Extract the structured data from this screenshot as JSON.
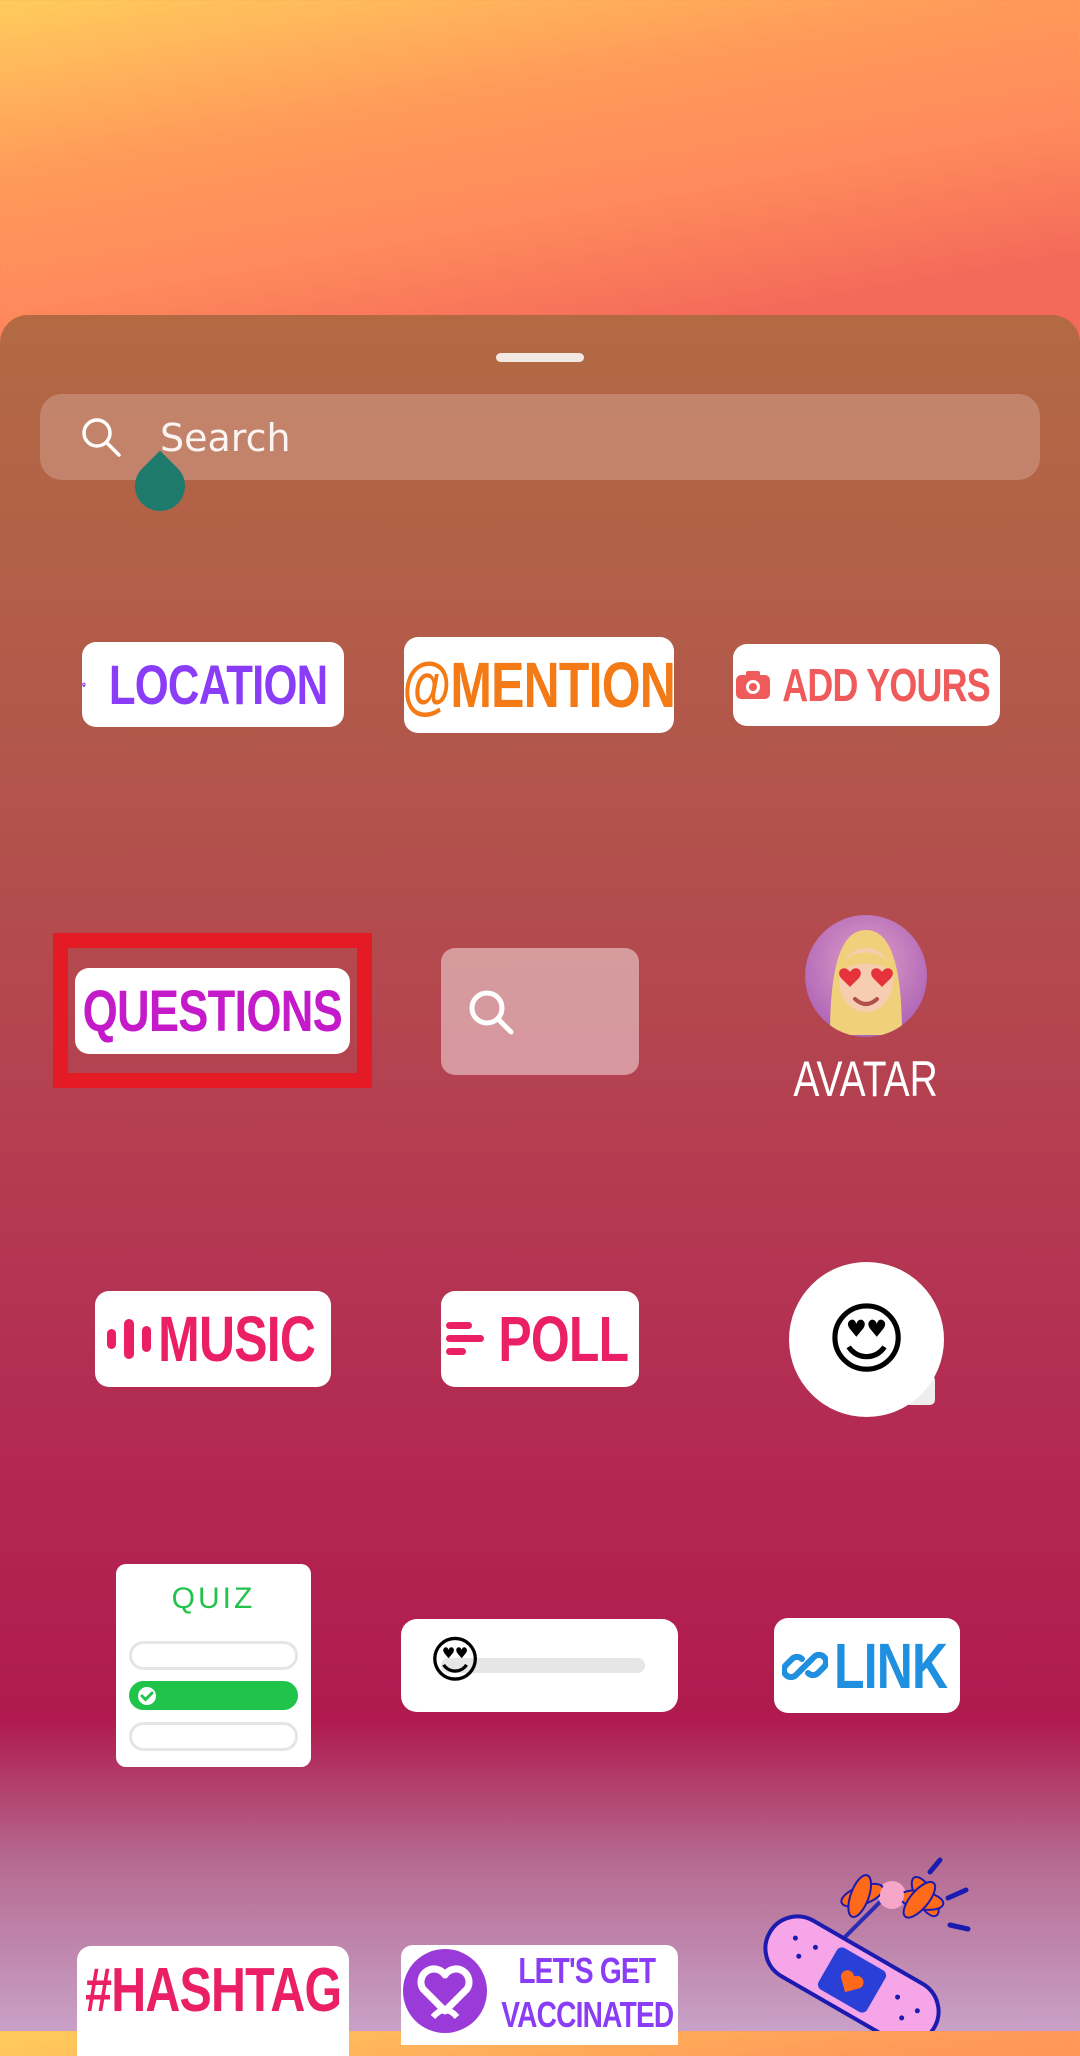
{
  "search": {
    "placeholder": "Search"
  },
  "stickers": {
    "location": "LOCATION",
    "mention": "@MENTION",
    "add_yours": "ADD YOURS",
    "questions": "QUESTIONS",
    "avatar": "AVATAR",
    "music": "MUSIC",
    "poll": "POLL",
    "quiz": "QUIZ",
    "link": "LINK",
    "hashtag": "#HASHTAG",
    "vaccinated_line1": "LET'S GET",
    "vaccinated_line2": "VACCINATED"
  },
  "slider": {
    "emoji": "😍",
    "value_fraction": 0.0
  },
  "emoji_sticker": {
    "emoji": "😍"
  },
  "colors": {
    "location": "#8a3cf6",
    "mention": "#f47a16",
    "add_yours": "#ef5a5a",
    "questions": "#c51ac9",
    "music": "#ea1f66",
    "poll": "#ea1f66",
    "quiz": "#21c44a",
    "link": "#1f8fe0",
    "hashtag": "#ea1f66",
    "vaccinated": "#8a3cf6",
    "highlight": "#e41b24"
  }
}
